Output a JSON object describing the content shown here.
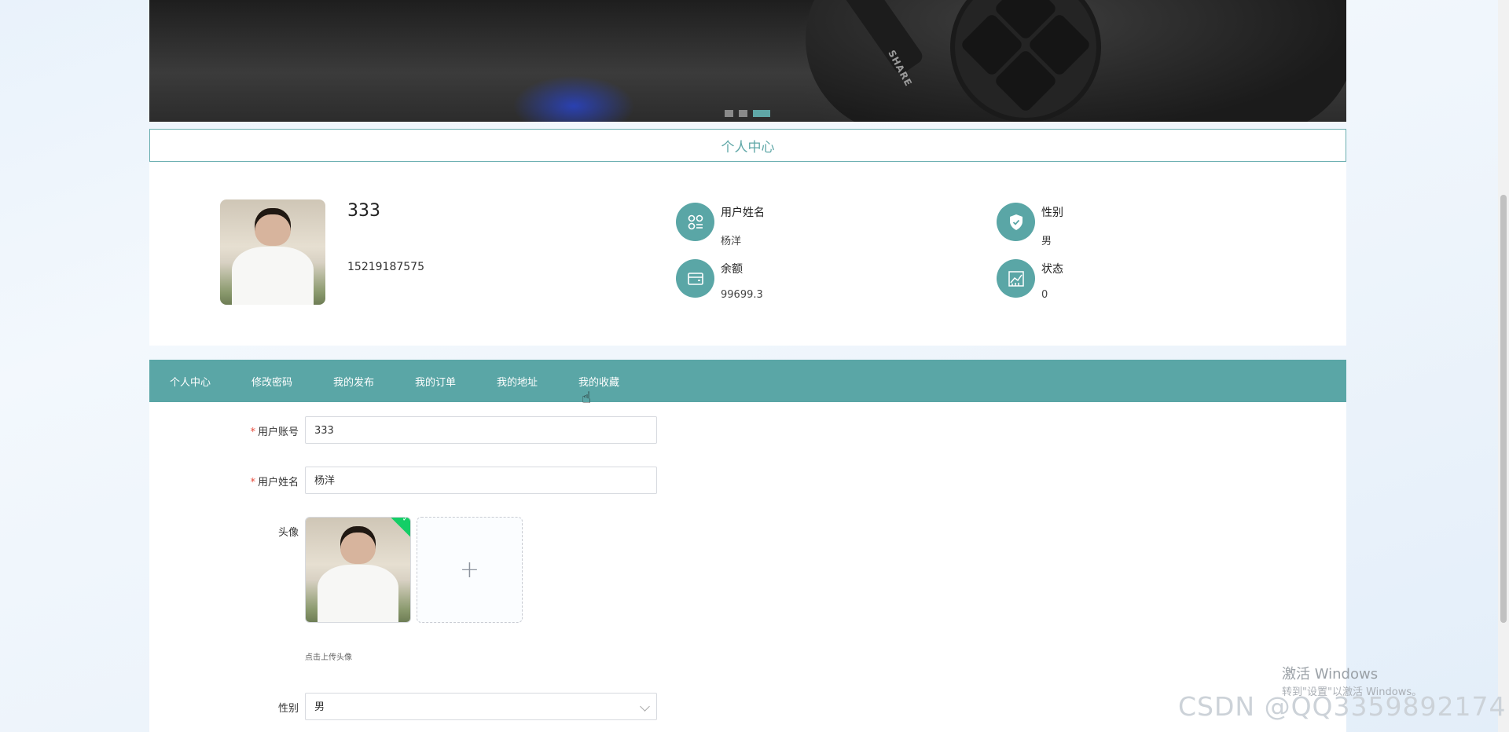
{
  "banner": {
    "share_text": "SHARE",
    "carousel_dots": 3,
    "active_dot": 3
  },
  "section_title": "个人中心",
  "profile": {
    "username": "333",
    "phone": "15219187575",
    "info": [
      {
        "label": "用户姓名",
        "value": "杨洋",
        "icon": "apps-icon"
      },
      {
        "label": "性别",
        "value": "男",
        "icon": "shield-check-icon"
      },
      {
        "label": "余额",
        "value": "99699.3",
        "icon": "wallet-icon"
      },
      {
        "label": "状态",
        "value": "0",
        "icon": "chart-icon"
      }
    ]
  },
  "tabs": [
    "个人中心",
    "修改密码",
    "我的发布",
    "我的订单",
    "我的地址",
    "我的收藏"
  ],
  "form": {
    "account_label": "用户账号",
    "account_value": "333",
    "name_label": "用户姓名",
    "name_value": "杨洋",
    "avatar_label": "头像",
    "upload_plus": "+",
    "upload_hint": "点击上传头像",
    "gender_label": "性别",
    "gender_value": "男"
  },
  "watermarks": {
    "windows_title": "激活 Windows",
    "windows_sub": "转到\"设置\"以激活 Windows。",
    "csdn": "CSDN @QQ3359892174"
  },
  "colors": {
    "accent": "#5aa6a6",
    "required": "#e74c3c",
    "success": "#13ce66"
  }
}
